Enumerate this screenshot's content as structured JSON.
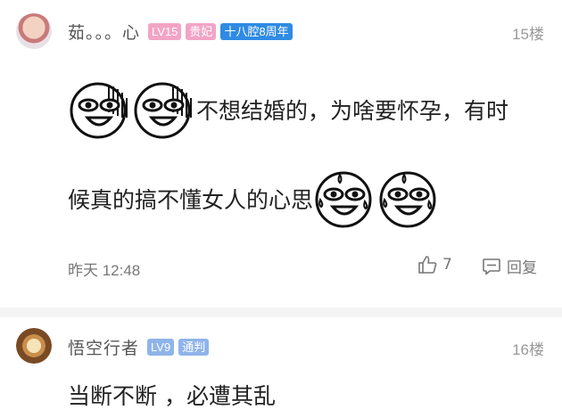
{
  "comments": [
    {
      "username": "茹。。。心",
      "level": "LV15",
      "titles": [
        "贵妃",
        "十八腔8周年"
      ],
      "floor": "15楼",
      "line1": "不想结婚的，为啥要怀孕，有时",
      "line2": "候真的搞不懂女人的心思",
      "time": "昨天 12:48",
      "likes": "7",
      "reply_label": "回复",
      "emoji_line1": [
        "funny-face-icon",
        "funny-face-icon"
      ],
      "emoji_line2": [
        "sweat-face-icon",
        "sweat-face-icon"
      ]
    },
    {
      "username": "悟空行者",
      "level": "LV9",
      "titles": [
        "通判"
      ],
      "floor": "16楼",
      "text": "当断不断 ，必遭其乱"
    }
  ],
  "colors": {
    "level_pink": "#f2a4c6",
    "title_blue": "#2f8be3",
    "level_blue": "#8fb4ea"
  }
}
